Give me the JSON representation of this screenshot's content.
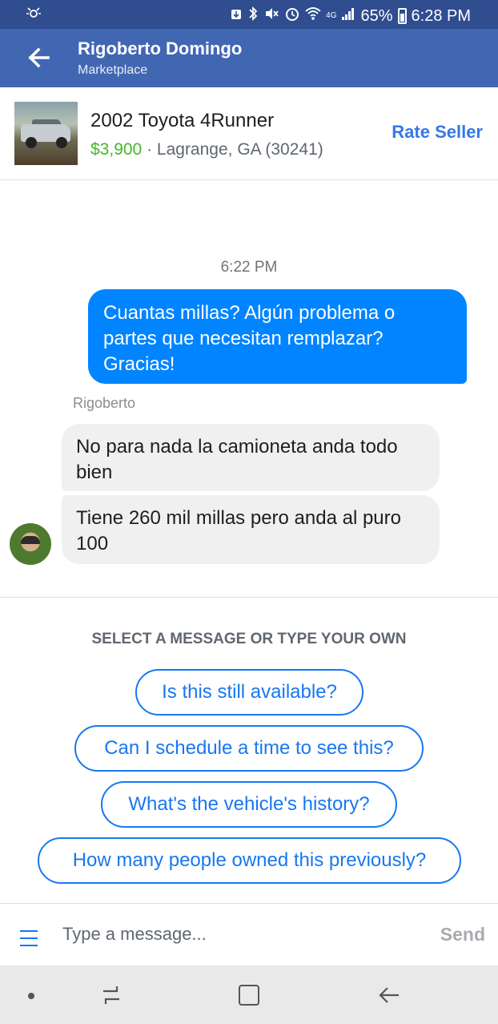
{
  "status_bar": {
    "battery": "65%",
    "time": "6:28 PM",
    "network": "4G",
    "icons": [
      "hotspot-icon",
      "android-download-icon",
      "bluetooth-icon",
      "mute-icon",
      "alarm-icon",
      "wifi-icon",
      "signal-icon",
      "battery-icon"
    ]
  },
  "header": {
    "title": "Rigoberto Domingo",
    "subtitle": "Marketplace",
    "back_icon": "back-arrow-icon"
  },
  "listing": {
    "title": "2002 Toyota 4Runner",
    "price": "$3,900",
    "separator": " · ",
    "location": "Lagrange, GA (30241)",
    "rate_seller_label": "Rate Seller"
  },
  "chat": {
    "timestamp": "6:22 PM",
    "outgoing_message": "Cuantas millas? Algún problema o partes que necesitan remplazar? Gracias!",
    "sender_name": "Rigoberto",
    "incoming_messages": [
      "No para nada la camioneta anda todo bien",
      "Tiene 260 mil millas pero anda al puro 100"
    ]
  },
  "suggestions": {
    "heading": "SELECT A MESSAGE OR TYPE YOUR OWN",
    "items": [
      "Is this still available?",
      "Can I schedule a time to see this?",
      "What's the vehicle's history?",
      "How many people owned this previously?"
    ]
  },
  "composer": {
    "placeholder": "Type a message...",
    "send_label": "Send"
  },
  "colors": {
    "status_bar": "#2f4d8f",
    "header": "#4267b2",
    "outgoing_bubble": "#0084ff",
    "incoming_bubble": "#f1f0f0",
    "price": "#42b72a",
    "accent": "#1877f2"
  }
}
